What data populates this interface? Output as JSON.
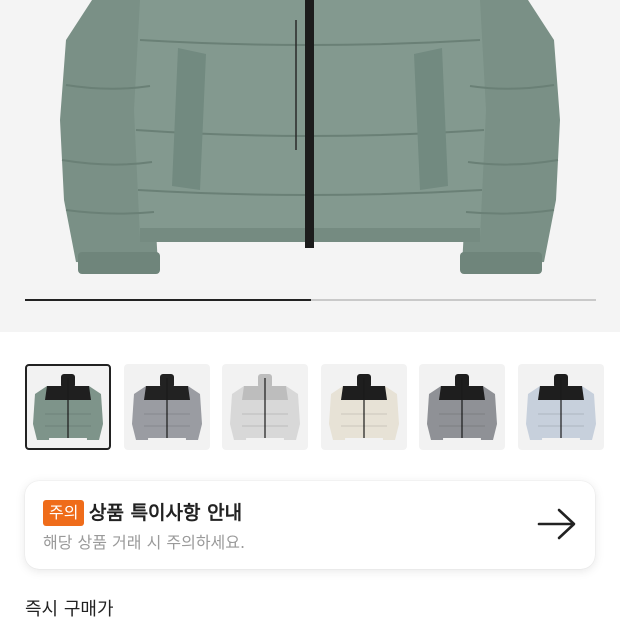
{
  "hero": {
    "image_name": "green-puffer-jacket",
    "slide_progress": 0.5
  },
  "thumbnails": [
    {
      "name": "green-black-puffer",
      "body": "#7e948a",
      "top": "#1f1f1f",
      "selected": true
    },
    {
      "name": "grey-black-puffer",
      "body": "#9a9ca2",
      "top": "#222222",
      "selected": false
    },
    {
      "name": "white-camo-puffer",
      "body": "#d8d8d8",
      "top": "#bdbdbd",
      "selected": false
    },
    {
      "name": "cream-black-puffer",
      "body": "#e7e2d6",
      "top": "#1e1e1e",
      "selected": false
    },
    {
      "name": "leopard-black-puffer",
      "body": "#8f9196",
      "top": "#1e1e1e",
      "selected": false
    },
    {
      "name": "blue-white-camo-puffer",
      "body": "#c7d0dc",
      "top": "#1e1e1e",
      "selected": false
    }
  ],
  "notice": {
    "badge": "주의",
    "title": "상품 특이사항 안내",
    "description": "해당 상품 거래 시 주의하세요.",
    "arrow_icon": "arrow-right-icon"
  },
  "section": {
    "label": "즉시 구매가"
  },
  "colors": {
    "accent": "#ef6c1a",
    "jacket_green": "#7e948a"
  }
}
